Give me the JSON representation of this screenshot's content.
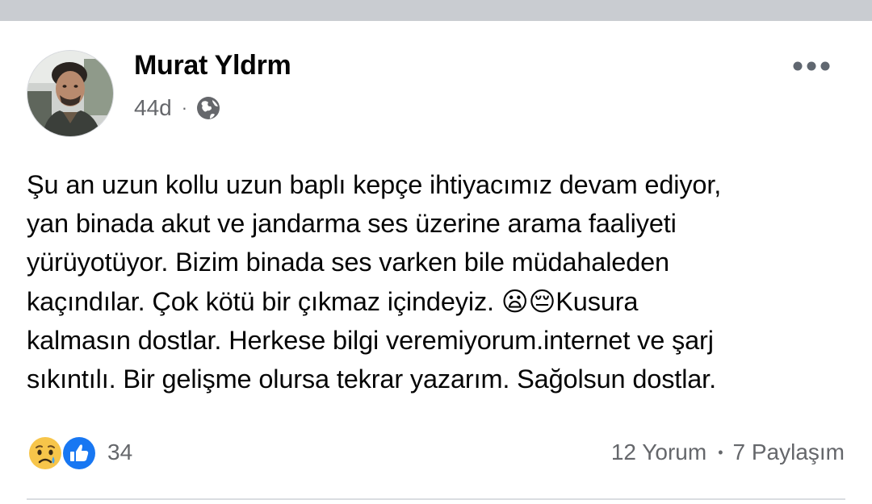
{
  "post": {
    "author": {
      "name": "Murat Yldrm"
    },
    "meta": {
      "time": "44d",
      "separator": "·",
      "audience_icon": "globe-icon"
    },
    "more_icon": "more-options-icon",
    "text": "Şu an uzun kollu uzun baplı kepçe ihtiyacımız devam ediyor,\nyan binada akut ve jandarma ses üzerine arama faaliyeti\nyürüyotüyor. Bizim binada ses varken bile müdahaleden\nkaçındılar. Çok kötü bir çıkmaz içindeyiz. 😦😔Kusura\nkalmasın dostlar. Herkese bilgi veremiyorum.internet ve şarj\nsıkıntılı. Bir gelişme olursa tekrar yazarım. Sağolsun dostlar."
  },
  "reactions": {
    "icons": [
      "sad-emoji-icon",
      "like-icon"
    ],
    "count": "34"
  },
  "engagement": {
    "comments": "12 Yorum",
    "separator": "•",
    "shares": "7 Paylaşım"
  },
  "colors": {
    "text_primary": "#050505",
    "text_secondary": "#65676b",
    "like_blue": "#1877f2",
    "top_strip": "#c9ccd1",
    "divider": "#dadde1"
  }
}
